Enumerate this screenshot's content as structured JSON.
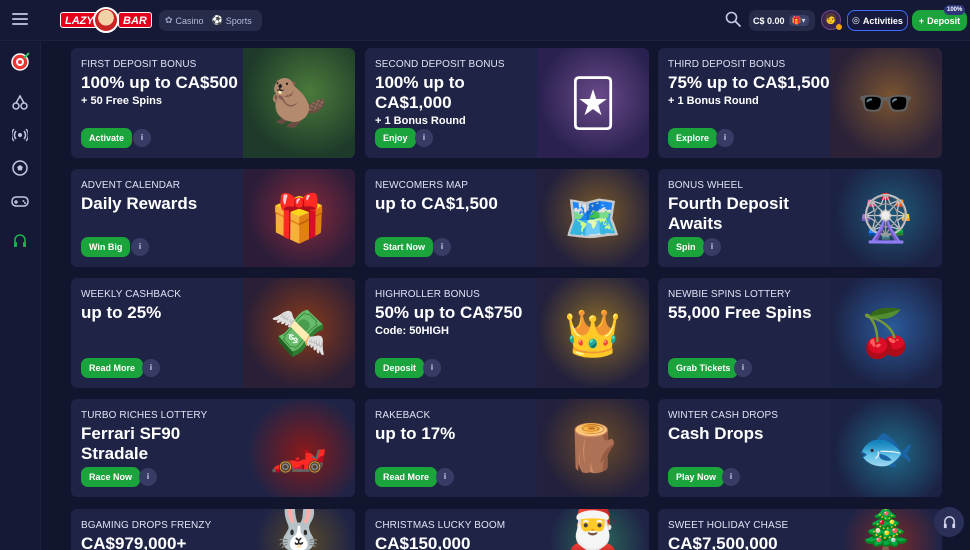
{
  "header": {
    "logo_left": "LAZY",
    "logo_right": "BAR",
    "nav": [
      {
        "label": "Casino",
        "icon": "casino-chip-icon"
      },
      {
        "label": "Sports",
        "icon": "soccer-ball-icon"
      }
    ],
    "balance": "C$ 0.00",
    "activities_label": "Activities",
    "deposit_label": "Deposit",
    "deposit_badge": "100%"
  },
  "sidebar": {
    "items": [
      {
        "name": "dartboard-icon"
      },
      {
        "name": "cherries-icon"
      },
      {
        "name": "live-broadcast-icon"
      },
      {
        "name": "soccer-ball-icon"
      },
      {
        "name": "gamepad-icon"
      },
      {
        "name": "headset-icon"
      }
    ]
  },
  "colors": {
    "background": "#12152e",
    "card": "#1f2446",
    "accent_green": "#1ba33c",
    "activities_border": "#3e6dff"
  },
  "cards": [
    {
      "label": "FIRST DEPOSIT BONUS",
      "title": "100% up to CA$500",
      "sub": "+ 50 Free Spins",
      "cta": "Activate",
      "art": "capybara-cocktail-illustration"
    },
    {
      "label": "SECOND DEPOSIT BONUS",
      "title": "100% up to CA$1,000",
      "sub": "+ 1 Bonus Round",
      "cta": "Enjoy",
      "art": "capybara-cards-illustration"
    },
    {
      "label": "THIRD DEPOSIT BONUS",
      "title": "75% up to CA$1,500",
      "sub": "+ 1 Bonus Round",
      "cta": "Explore",
      "art": "capybara-bonus-sign-illustration"
    },
    {
      "label": "ADVENT CALENDAR",
      "title": "Daily Rewards",
      "sub": "",
      "cta": "Win Big",
      "art": "santa-girl-gift-illustration"
    },
    {
      "label": "NEWCOMERS MAP",
      "title": "up to CA$1,500",
      "sub": "",
      "cta": "Start Now",
      "art": "pirate-girl-map-illustration"
    },
    {
      "label": "BONUS WHEEL",
      "title": "Fourth Deposit Awaits",
      "sub": "",
      "cta": "Spin",
      "art": "bonus-wheel-illustration"
    },
    {
      "label": "WEEKLY CASHBACK",
      "title": "up to 25%",
      "sub": "",
      "cta": "Read More",
      "art": "cashback-sign-illustration"
    },
    {
      "label": "HIGHROLLER BONUS",
      "title": "50% up to CA$750",
      "sub": "Code: 50HIGH",
      "cta": "Deposit",
      "art": "queen-gold-chest-illustration"
    },
    {
      "label": "NEWBIE SPINS LOTTERY",
      "title": "55,000 Free Spins",
      "sub": "",
      "cta": "Grab Tickets",
      "art": "fruit-free-spins-illustration"
    },
    {
      "label": "TURBO RICHES LOTTERY",
      "title": "Ferrari SF90 Stradale",
      "sub": "",
      "cta": "Race Now",
      "art": "red-sports-car-illustration"
    },
    {
      "label": "RAKEBACK",
      "title": "up to 17%",
      "sub": "",
      "cta": "Read More",
      "art": "rakeback-sign-illustration"
    },
    {
      "label": "WINTER CASH DROPS",
      "title": "Cash Drops",
      "sub": "",
      "cta": "Play Now",
      "art": "fish-bowl-illustration"
    },
    {
      "label": "BGAMING DROPS FRENZY",
      "title": "CA$979,000+",
      "sub": "",
      "cta": "",
      "art": "bunny-coins-illustration"
    },
    {
      "label": "CHRISTMAS LUCKY BOOM",
      "title": "CA$150,000",
      "sub": "",
      "cta": "",
      "art": "christmas-dog-illustration"
    },
    {
      "label": "SWEET HOLIDAY CHASE",
      "title": "CA$7,500,000",
      "sub": "",
      "cta": "",
      "art": "santa-sleigh-illustration"
    }
  ]
}
